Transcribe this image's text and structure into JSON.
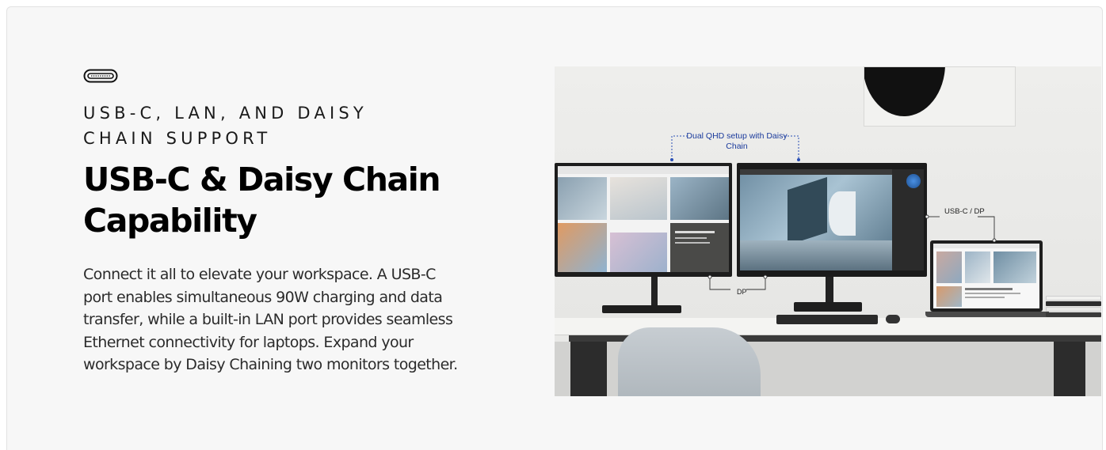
{
  "feature": {
    "icon": "usb-c-port-icon",
    "eyebrow": "USB-C, LAN, AND DAISY CHAIN SUPPORT",
    "headline": "USB-C & Daisy Chain Capability",
    "body": "Connect it all to elevate your workspace. A USB-C port enables simultaneous 90W charging and data transfer, while a built-in LAN port provides seamless Ethernet connectivity for laptops. Expand your workspace by Daisy Chaining two monitors together."
  },
  "product_image": {
    "callouts": {
      "daisy_chain": "Dual QHD setup with Daisy Chain",
      "usb_c_dp": "USB-C / DP",
      "dp": "DP"
    },
    "colors": {
      "callout_text": "#1a3a9c",
      "callout_line": "#2a4fb5",
      "background": "#f7f7f7"
    }
  }
}
